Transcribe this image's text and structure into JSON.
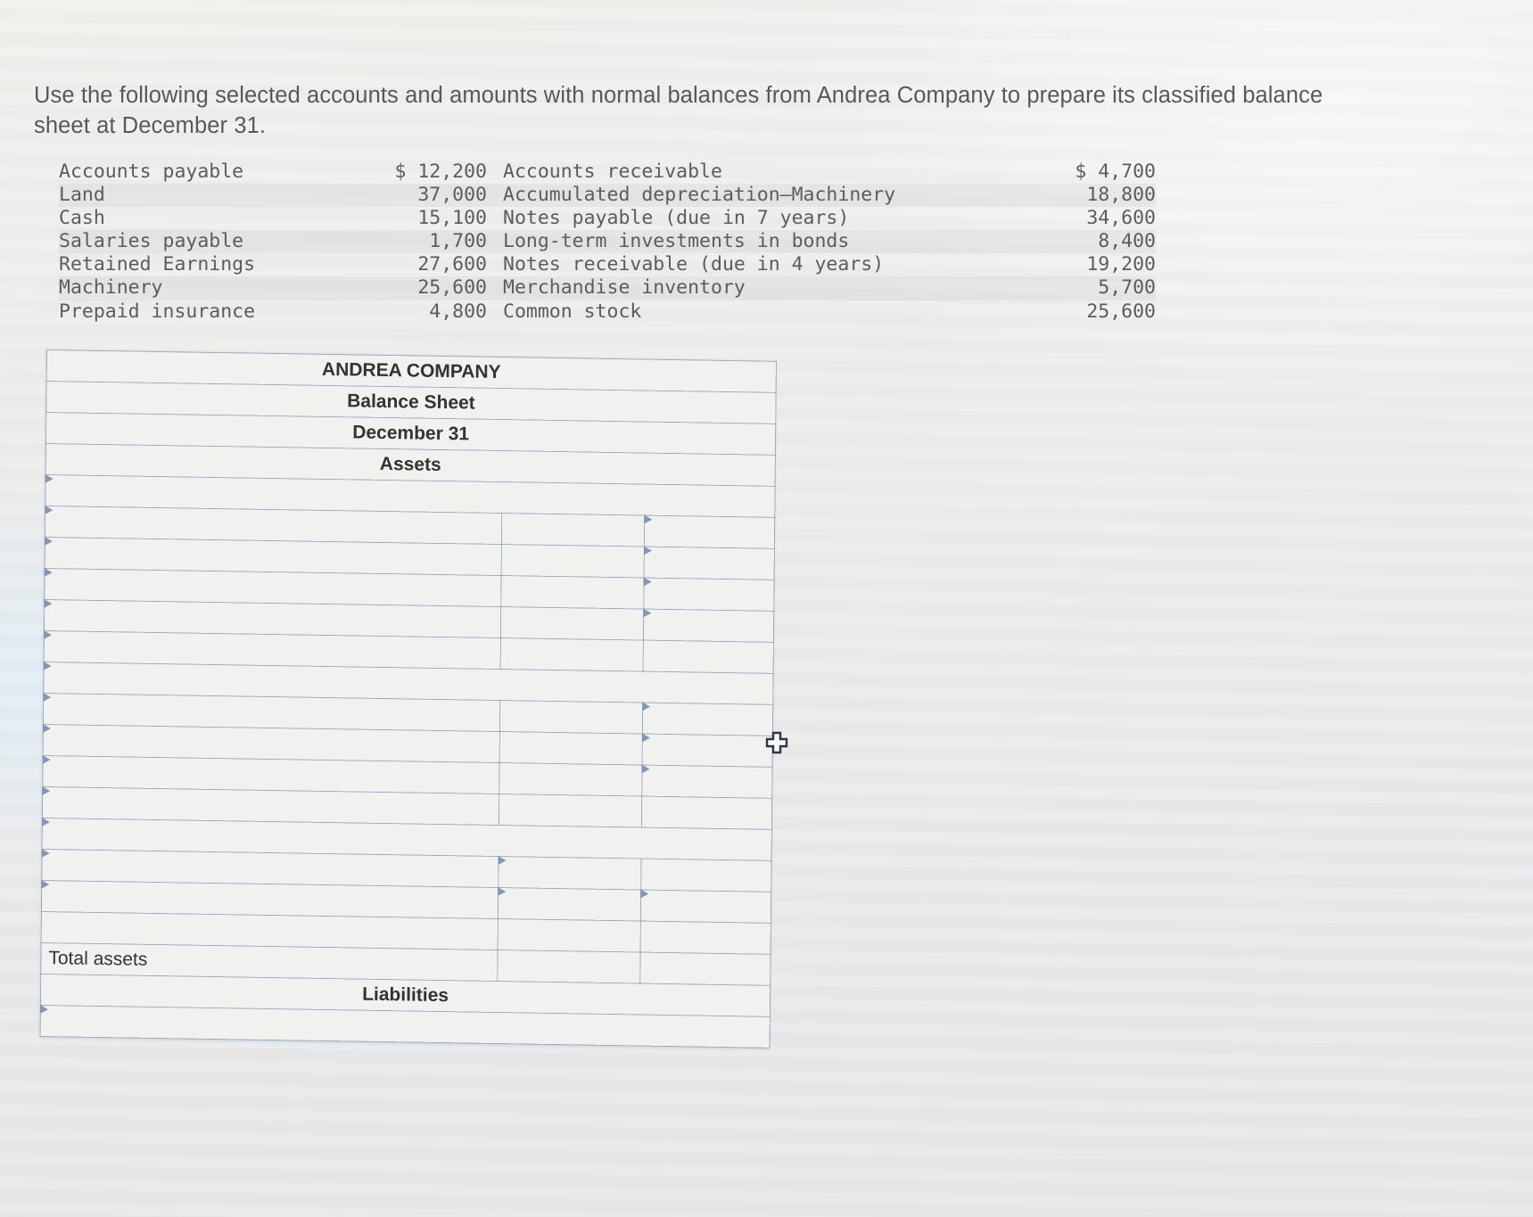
{
  "prompt": {
    "text": "Use the following selected accounts and amounts with normal balances from Andrea Company to prepare its classified balance sheet at December 31."
  },
  "accounts": {
    "rows": [
      {
        "name1": "Accounts payable",
        "amount1": "$ 12,200",
        "name2": "Accounts receivable",
        "amount2": "$ 4,700"
      },
      {
        "name1": "Land",
        "amount1": "37,000",
        "name2": "Accumulated depreciation—Machinery",
        "amount2": "18,800"
      },
      {
        "name1": "Cash",
        "amount1": "15,100",
        "name2": "Notes payable (due in 7 years)",
        "amount2": "34,600"
      },
      {
        "name1": "Salaries payable",
        "amount1": "1,700",
        "name2": "Long-term investments in bonds",
        "amount2": "8,400"
      },
      {
        "name1": "Retained Earnings",
        "amount1": "27,600",
        "name2": "Notes receivable (due in 4 years)",
        "amount2": "19,200"
      },
      {
        "name1": "Machinery",
        "amount1": "25,600",
        "name2": "Merchandise inventory",
        "amount2": "5,700"
      },
      {
        "name1": "Prepaid insurance",
        "amount1": "4,800",
        "name2": "Common stock",
        "amount2": "25,600"
      }
    ]
  },
  "balance_sheet": {
    "company": "ANDREA COMPANY",
    "statement": "Balance Sheet",
    "date": "December 31",
    "assets_header": "Assets",
    "total_assets_label": "Total assets",
    "liabilities_header": "Liabilities",
    "header_color": "#6f9ed2",
    "blank_cell": ""
  },
  "cursor": {
    "icon": "plus-cursor"
  }
}
